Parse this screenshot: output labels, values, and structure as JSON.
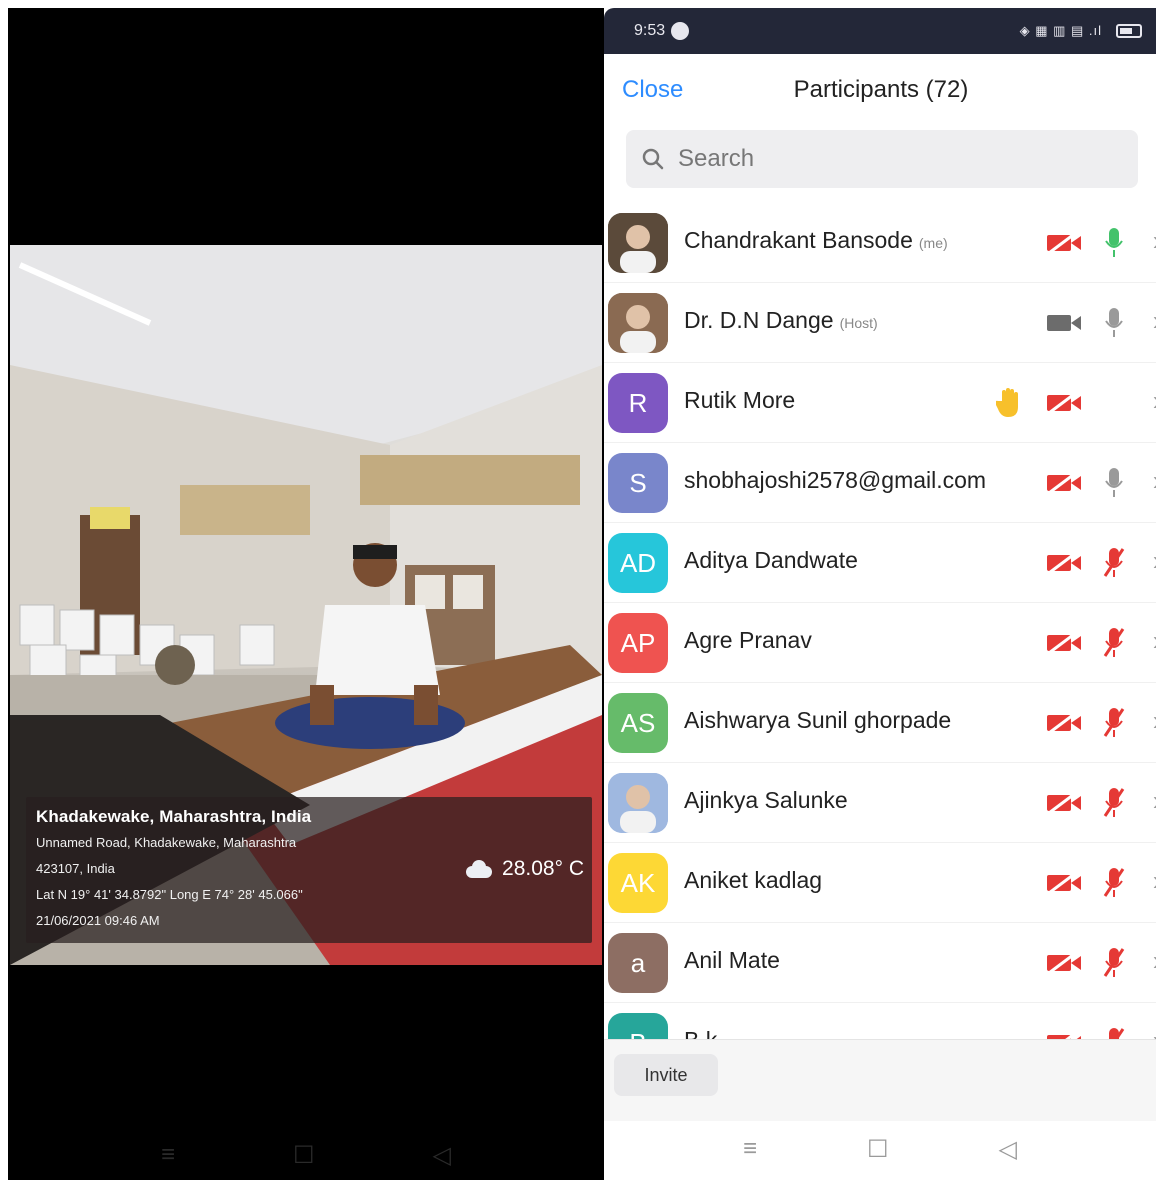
{
  "left_panel": {
    "geo": {
      "place": "Khadakewake, Maharashtra, India",
      "address_line1": "Unnamed Road, Khadakewake, Maharashtra",
      "address_line2": "423107, India",
      "coords": "Lat N 19° 41' 34.8792\" Long E 74° 28' 45.066\"",
      "datetime": "21/06/2021 09:46 AM",
      "temperature": "28.08° C",
      "weather_icon": "cloud-icon"
    },
    "nav": [
      "≡",
      "☐",
      "◁"
    ]
  },
  "right_panel": {
    "status": {
      "time": "9:53",
      "icons": "◈ ▦ ▥ ▤ .ıl"
    },
    "header": {
      "close_label": "Close",
      "title": "Participants (72)"
    },
    "search": {
      "placeholder": "Search"
    },
    "participants": [
      {
        "name": "Chandrakant Bansode",
        "tag": "(me)",
        "initials": "",
        "avatar_color": "#5b4a3a",
        "photo": true,
        "video": "off",
        "mic": "on",
        "hand": false
      },
      {
        "name": "Dr. D.N Dange",
        "tag": "(Host)",
        "initials": "",
        "avatar_color": "#8a6a52",
        "photo": true,
        "video": "on",
        "mic": "idle",
        "hand": false
      },
      {
        "name": "Rutik More",
        "tag": "",
        "initials": "R",
        "avatar_color": "#7e57c2",
        "photo": false,
        "video": "off",
        "mic": "none",
        "hand": true
      },
      {
        "name": "shobhajoshi2578@gmail.com",
        "tag": "",
        "initials": "S",
        "avatar_color": "#7986cb",
        "photo": false,
        "video": "off",
        "mic": "idle",
        "hand": false
      },
      {
        "name": "Aditya Dandwate",
        "tag": "",
        "initials": "AD",
        "avatar_color": "#26c6da",
        "photo": false,
        "video": "off",
        "mic": "muted",
        "hand": false
      },
      {
        "name": "Agre Pranav",
        "tag": "",
        "initials": "AP",
        "avatar_color": "#ef5350",
        "photo": false,
        "video": "off",
        "mic": "muted",
        "hand": false
      },
      {
        "name": "Aishwarya Sunil ghorpade",
        "tag": "",
        "initials": "AS",
        "avatar_color": "#66bb6a",
        "photo": false,
        "video": "off",
        "mic": "muted",
        "hand": false
      },
      {
        "name": "Ajinkya Salunke",
        "tag": "",
        "initials": "",
        "avatar_color": "#9fb8e0",
        "photo": true,
        "video": "off",
        "mic": "muted",
        "hand": false
      },
      {
        "name": "Aniket kadlag",
        "tag": "",
        "initials": "AK",
        "avatar_color": "#fdd835",
        "photo": false,
        "video": "off",
        "mic": "muted",
        "hand": false
      },
      {
        "name": "Anil Mate",
        "tag": "",
        "initials": "a",
        "avatar_color": "#8d6e63",
        "photo": false,
        "video": "off",
        "mic": "muted",
        "hand": false
      },
      {
        "name": "B k",
        "tag": "",
        "initials": "B",
        "avatar_color": "#26a69a",
        "photo": false,
        "video": "off",
        "mic": "muted",
        "hand": false
      }
    ],
    "invite_label": "Invite",
    "nav": [
      "≡",
      "☐",
      "◁"
    ],
    "colors": {
      "accent": "#2d8cff",
      "danger": "#e53935",
      "mic_on": "#43c26b",
      "idle": "#9a9a9a"
    }
  }
}
